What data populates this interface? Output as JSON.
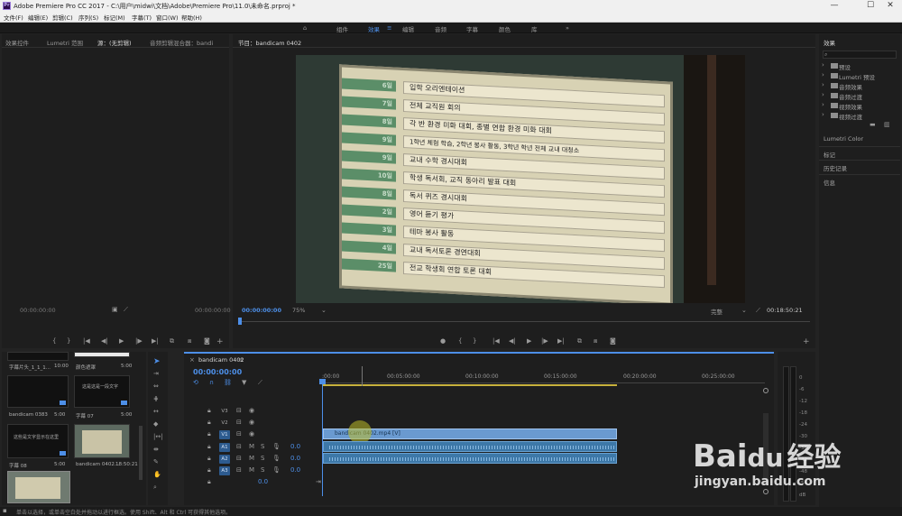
{
  "app": {
    "title": "Adobe Premiere Pro CC 2017 - C:\\用户\\midwi\\文档\\Adobe\\Premiere Pro\\11.0\\未命名.prproj *",
    "logo_text": "Pr"
  },
  "window_controls": {
    "minimize": "—",
    "maximize": "☐",
    "close": "✕"
  },
  "menu": [
    "文件(F)",
    "编辑(E)",
    "剪辑(C)",
    "序列(S)",
    "标记(M)",
    "字幕(T)",
    "窗口(W)",
    "帮助(H)"
  ],
  "workspaces": {
    "home_icon": "⌂",
    "items": [
      "组件",
      "效果",
      "≡",
      "编辑",
      "音频",
      "字幕",
      "颜色",
      "库"
    ],
    "active_index": 1,
    "more": "»"
  },
  "source_panel": {
    "tabs": [
      "效果控件",
      "Lumetri 范围",
      "源：(无剪辑)",
      "音频剪辑混合器：bandi"
    ],
    "active_tab": 2,
    "timecode_left": "00:00:00:00",
    "timecode_right": "00:00:00:00"
  },
  "program_panel": {
    "tab": "节目：bandicam 0402",
    "timecode": "00:00:00:00",
    "zoom": "75%",
    "quality": "完整",
    "duration": "00:18:50:21"
  },
  "board_rows": [
    {
      "day": "6일",
      "text": "입학 오리엔테이션"
    },
    {
      "day": "7일",
      "text": "전체 교직원 회의"
    },
    {
      "day": "8일",
      "text": "각 반 환경 미화 대회, 종별 연합 환경 미화 대회"
    },
    {
      "day": "9일",
      "text": "1학년 체험 학습, 2학년 봉사 활동, 3학년 학년 전체 교내 대청소"
    },
    {
      "day": "9일",
      "text": "교내 수학 경시대회"
    },
    {
      "day": "10일",
      "text": "학생 독서회, 교직 동아리 발표 대회"
    },
    {
      "day": "8일",
      "text": "독서 퀴즈 경시대회"
    },
    {
      "day": "2일",
      "text": "영어 듣기 평가"
    },
    {
      "day": "3일",
      "text": "테마 봉사 활동"
    },
    {
      "day": "4일",
      "text": "교내 독서토론 경연대회"
    },
    {
      "day": "25일",
      "text": "전교 학생회 연합 토론 대회"
    }
  ],
  "project_panel": {
    "items": [
      {
        "name": "字幕片头_1_1_1...",
        "duration": "10:00"
      },
      {
        "name": "颜色遮罩",
        "duration": "5:00"
      },
      {
        "name": "bandicam 0383",
        "duration": "5:00"
      },
      {
        "name": "字幕 07",
        "duration": "5:00"
      },
      {
        "name": "字幕 08",
        "duration": "5:00"
      },
      {
        "name": "bandicam 0402...",
        "duration": "18:50:21"
      }
    ],
    "thumb_text_1": "这是这是一段文字",
    "thumb_text_2": "这些是文字显示在这里"
  },
  "timeline": {
    "tab": "bandicam 0402",
    "timecode": "00:00:00:00",
    "ruler": [
      ":00:00",
      "00:05:00:00",
      "00:10:00:00",
      "00:15:00:00",
      "00:20:00:00",
      "00:25:00:00"
    ],
    "video_tracks": [
      "V3",
      "V2",
      "V1"
    ],
    "audio_tracks": [
      "A1",
      "A2",
      "A3"
    ],
    "audio_level": "0.0",
    "master_level": "0.0",
    "clip_label": "bandicam 0402.mp4 [V]",
    "track_buttons": {
      "mute": "M",
      "solo": "S"
    }
  },
  "effects_panel": {
    "title": "效果",
    "search_placeholder": "",
    "folders": [
      "预设",
      "Lumetri 预设",
      "音频效果",
      "音频过渡",
      "视频效果",
      "视频过渡"
    ],
    "sections": [
      "Lumetri Color",
      "标记",
      "历史记录",
      "信息"
    ]
  },
  "meter_ticks": [
    "0",
    "-6",
    "-12",
    "-18",
    "-24",
    "-30",
    "-36",
    "-42",
    "-48",
    "-54",
    "dB"
  ],
  "status_bar": {
    "text": "单击以选择，或单击空白处并拖动以进行框选。使用 Shift、Alt 和 Ctrl 可获得其他选项。"
  },
  "watermark": {
    "logo": "Bai",
    "paw": "du",
    "brand": "经验",
    "url": "jingyan.baidu.com"
  }
}
